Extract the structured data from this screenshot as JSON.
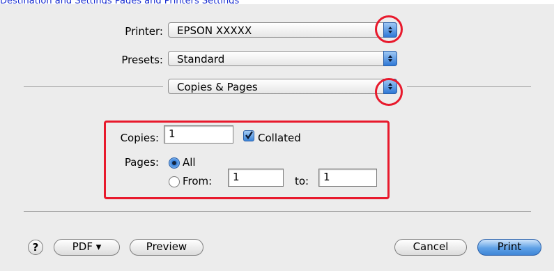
{
  "top_link": "Destination and Settings Pages and Printers Settings",
  "printer": {
    "label": "Printer:",
    "value": "EPSON XXXXX"
  },
  "presets": {
    "label": "Presets:",
    "value": "Standard"
  },
  "panel": {
    "value": "Copies & Pages"
  },
  "copies": {
    "label": "Copies:",
    "value": "1",
    "collated_label": "Collated",
    "collated_checked": true
  },
  "pages": {
    "label": "Pages:",
    "all_label": "All",
    "from_label": "From:",
    "from_value": "1",
    "to_label": "to:",
    "to_value": "1",
    "selected": "All"
  },
  "buttons": {
    "help": "?",
    "pdf": "PDF ▾",
    "preview": "Preview",
    "cancel": "Cancel",
    "print": "Print"
  },
  "colors": {
    "highlight": "#e8192c",
    "accent": "#3b85d9"
  }
}
